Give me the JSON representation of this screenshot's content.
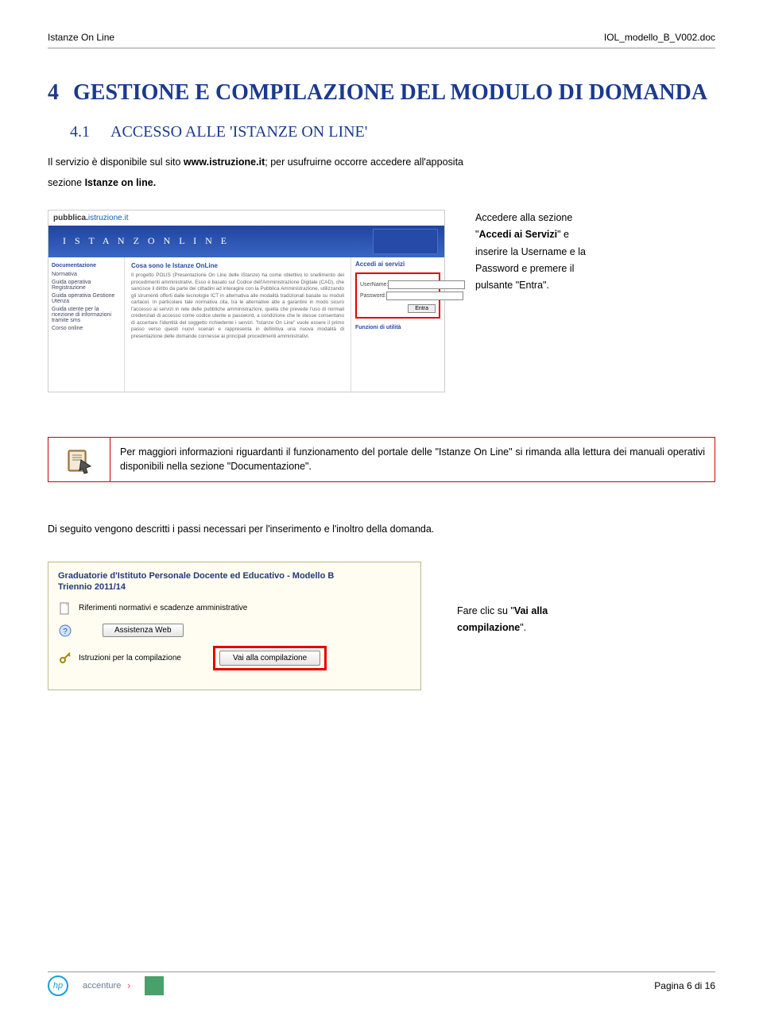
{
  "header": {
    "left": "Istanze On Line",
    "right": "IOL_modello_B_V002.doc"
  },
  "h1": {
    "num": "4",
    "text": "GESTIONE E COMPILAZIONE DEL MODULO DI DOMANDA"
  },
  "h2": {
    "num": "4.1",
    "text": "ACCESSO ALLE 'ISTANZE ON LINE'"
  },
  "intro": {
    "line1_a": "Il servizio è disponibile sul sito ",
    "line1_link": "www.istruzione.it",
    "line1_b": "; per usufruirne occorre accedere all'apposita",
    "line2_a": "sezione ",
    "line2_bold": "Istanze on line."
  },
  "fig1": {
    "pubblica": "pubblica.",
    "istruzione": "istruzione.it",
    "banner": "I S T A N Z  O N  L I N E",
    "nav_header": "Documentazione",
    "nav_items": [
      "Normativa",
      "Guida operativa Registrazione",
      "Guida operativa Gestione Utenza",
      "Guida utente per la ricezione di informazioni tramite sms",
      "Corso online"
    ],
    "mid_header": "Cosa sono le Istanze OnLine",
    "mid_text": "Il progetto POLIS (Presentazione On Line delle IStanze) ha come obiettivo lo snellimento dei procedimenti amministrativi. Esso è basato sul Codice dell'Amministrazione Digitale (CAD), che sancisce il diritto da parte dei cittadini ad interagire con la Pubblica Amministrazione, utilizzando gli strumenti offerti dalle tecnologie ICT in alternativa alle modalità tradizionali basate su moduli cartacei. In particolare tale normativa cita, tra le alternative atte a garantire in modo sicuro l'accesso ai servizi in rete delle pubbliche amministrazioni, quella che prevede l'uso di normali credenziali di accesso come codice utente e password, a condizione che le stesse consentano di accertare l'identità del soggetto richiedente i servizi. \"Istanze On Line\" vuole essere il primo passo verso questi nuovi scenari e rappresenta in definitiva una nuova modalità di presentazione delle domande connesse ai principali procedimenti amministrativi.",
    "right_header": "Accedi ai servizi",
    "username_label": "UserName:",
    "password_label": "Password:",
    "entra": "Entra",
    "funzioni": "Funzioni di utilità"
  },
  "fig1_caption": {
    "t1": "Accedere alla sezione",
    "t2_a": "\"",
    "t2_bold": "Accedi ai Servizi",
    "t2_b": "\" e",
    "t3": "inserire la Username e la",
    "t4": "Password e premere il",
    "t5": "pulsante \"Entra\"."
  },
  "notice": {
    "text": "Per maggiori informazioni riguardanti il funzionamento del portale delle \"Istanze On Line\" si rimanda alla lettura dei manuali operativi disponibili nella sezione \"Documentazione\"."
  },
  "follow": "Di seguito vengono descritti i passi necessari per l'inserimento e l'inoltro della domanda.",
  "fig2": {
    "title_line1": "Graduatorie d'Istituto Personale Docente ed Educativo - Modello B",
    "title_line2": "Triennio 2011/14",
    "row1": "Riferimenti normativi e scadenze amministrative",
    "assistenza": "Assistenza Web",
    "row3": "Istruzioni per la compilazione",
    "compile": "Vai alla compilazione"
  },
  "fig2_caption": {
    "t1_a": "Fare clic su \"",
    "t1_bold": "Vai alla",
    "t2_bold": "compilazione",
    "t2_b": "\"."
  },
  "footer": {
    "hp": "hp",
    "accenture": "accenture",
    "pagenum": "Pagina 6 di 16"
  }
}
